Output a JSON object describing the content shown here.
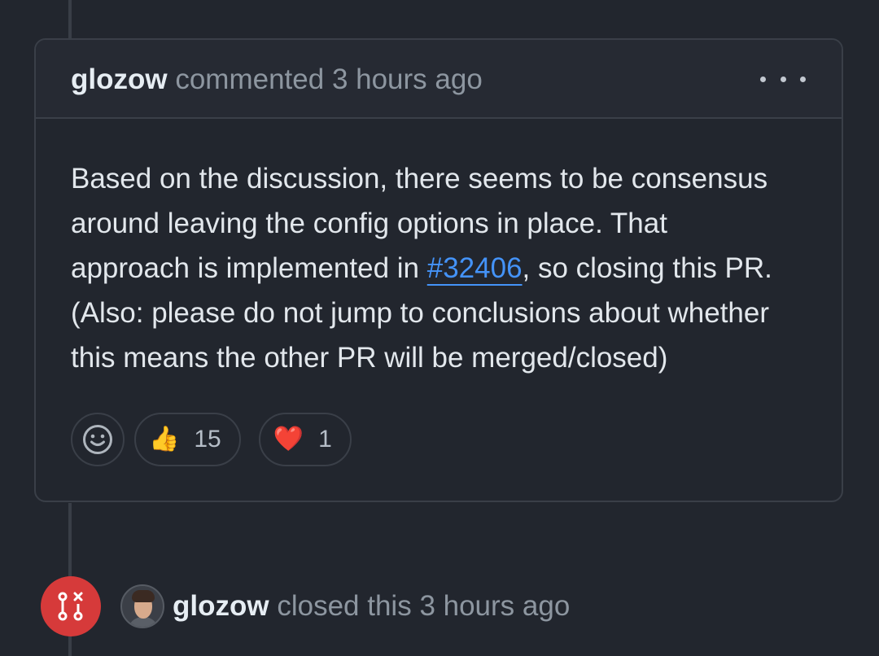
{
  "comment": {
    "author": "glozow",
    "action": "commented",
    "time": "3 hours ago",
    "body": {
      "line1": "Based on the discussion, there seems to be consensus",
      "line2": "around leaving the config options in place. That",
      "line3_before": "approach is implemented in ",
      "link_text": "#32406",
      "line3_after": ", so closing this PR.",
      "line4": "(Also: please do not jump to conclusions about whether",
      "line5": "this means the other PR will be merged/closed)"
    },
    "reactions": [
      {
        "emoji": "👍",
        "icon": "thumbs-up-icon",
        "count": "15"
      },
      {
        "emoji": "❤️",
        "icon": "heart-icon",
        "count": "1"
      }
    ]
  },
  "closed_event": {
    "author": "glozow",
    "action": "closed this",
    "time": "3 hours ago",
    "icon": "git-pull-request-closed-icon",
    "color": "#d63a3a"
  },
  "colors": {
    "background": "#22262e",
    "border": "#3a3f48",
    "muted_text": "#8d96a0",
    "link": "#4493f8"
  }
}
